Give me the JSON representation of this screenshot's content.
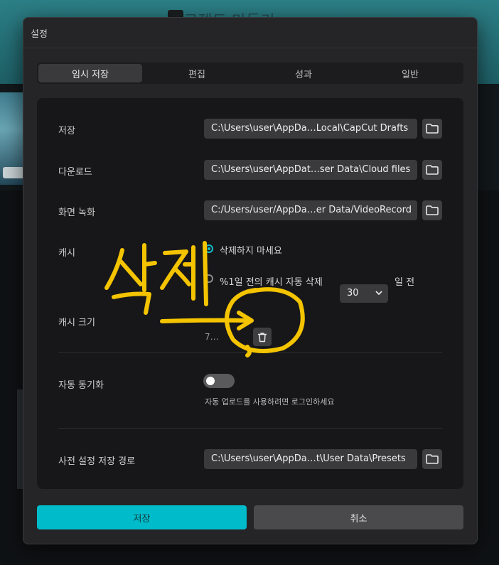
{
  "background": {
    "app_title": "프로젝트 만들기"
  },
  "dialog": {
    "title": "설정",
    "tabs": [
      {
        "label": "임시 저장",
        "active": true
      },
      {
        "label": "편집",
        "active": false
      },
      {
        "label": "성과",
        "active": false
      },
      {
        "label": "일반",
        "active": false
      }
    ],
    "rows": {
      "save": {
        "label": "저장",
        "path": "C:\\Users\\user\\AppDa…Local\\CapCut Drafts"
      },
      "download": {
        "label": "다운로드",
        "path": "C:\\Users\\user\\AppDat…ser Data\\Cloud files"
      },
      "screen_record": {
        "label": "화면 녹화",
        "path": "C:/Users/user/AppDa…er Data/VideoRecord"
      },
      "cache": {
        "label": "캐시",
        "option_keep": "삭제하지 마세요",
        "option_auto_prefix": "%1일 전의 캐시 자동 삭제",
        "days_value": "30",
        "option_auto_suffix": "일 전",
        "selected": "keep"
      },
      "cache_size": {
        "label": "캐시 크기",
        "value": "7…"
      },
      "auto_sync": {
        "label": "자동 동기화",
        "enabled": false,
        "hint": "자동 업로드를 사용하려면 로그인하세요"
      },
      "preset_path": {
        "label": "사전 설정 저장 경로",
        "path": "C:\\Users\\user\\AppDa…t\\User Data\\Presets"
      }
    },
    "buttons": {
      "save": "저장",
      "cancel": "취소"
    }
  },
  "annotation": {
    "handwritten_text": "삭제",
    "color": "#f5c400"
  },
  "colors": {
    "accent": "#00bcca",
    "panel": "#171719",
    "dialog": "#252527"
  },
  "icons": [
    "folder-icon",
    "trash-icon",
    "chevron-down-icon"
  ]
}
